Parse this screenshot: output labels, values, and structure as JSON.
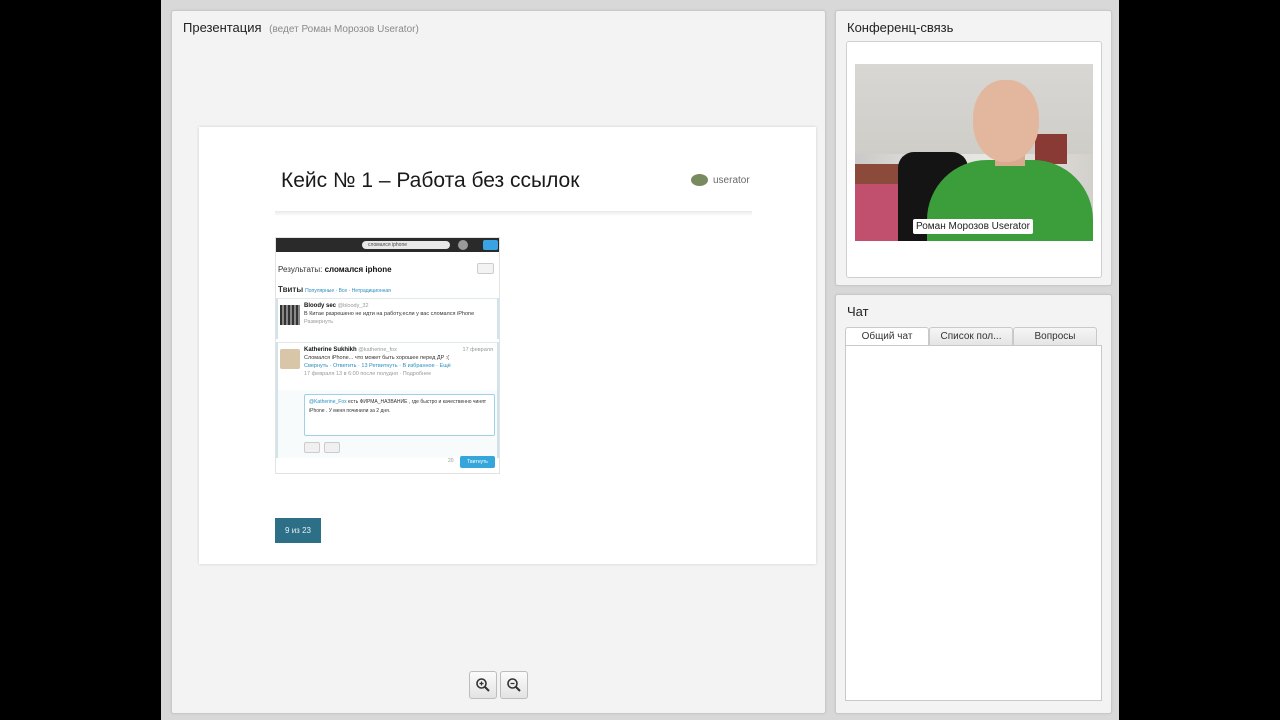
{
  "presentation": {
    "title": "Презентация",
    "subtitle": "(ведет Роман Морозов Userator)",
    "slide": {
      "title": "Кейс № 1 – Работа без ссылок",
      "logo_text": "userator",
      "page_indicator": "9 из 23"
    },
    "embedded_screenshot": {
      "search_text": "сломался iphone",
      "results_label": "Результаты:",
      "results_query": "сломался iphone",
      "tabs_title": "Твиты",
      "tabs_options": "Популярные · Все · Нетрадиционная",
      "tweets": [
        {
          "author": "Bloody sec",
          "handle": "@bloody_32",
          "text": "В Китае разрешено не идти на работу,если у вас сломался iPhone",
          "meta": "Развернуть"
        },
        {
          "author": "Katherine Sukhikh",
          "handle": "@katherine_fox",
          "date": "17 февраля",
          "text": "Сломался iPhone... что может быть хорошее перед ДР :(",
          "actions": "Свернуть · Ответить · 13 Ретвитнуть · В избранное · Ещё",
          "timestamp": "17 февраля 13 в 6:00 после полудня · Подробнее"
        }
      ],
      "reply_mention": "@Katherine_Fox",
      "reply_text": " есть ФИРМА_НАЗВАНИЕ , где быстро и качественно чинят iPhone . У меня починили за 2 дня.",
      "reply_counter": "20",
      "reply_button": "Твитнуть"
    }
  },
  "conference": {
    "title": "Конференц-связь",
    "participant_name": "Роман Морозов Userator"
  },
  "chat": {
    "title": "Чат",
    "tabs": [
      "Общий чат",
      "Список пол...",
      "Вопросы"
    ],
    "active_tab": "Общий чат"
  },
  "colors": {
    "page_badge": "#2d6f86",
    "tweet_button": "#35a6dc"
  },
  "icons": {
    "zoom_in": "zoom-in-icon",
    "zoom_out": "zoom-out-icon"
  }
}
